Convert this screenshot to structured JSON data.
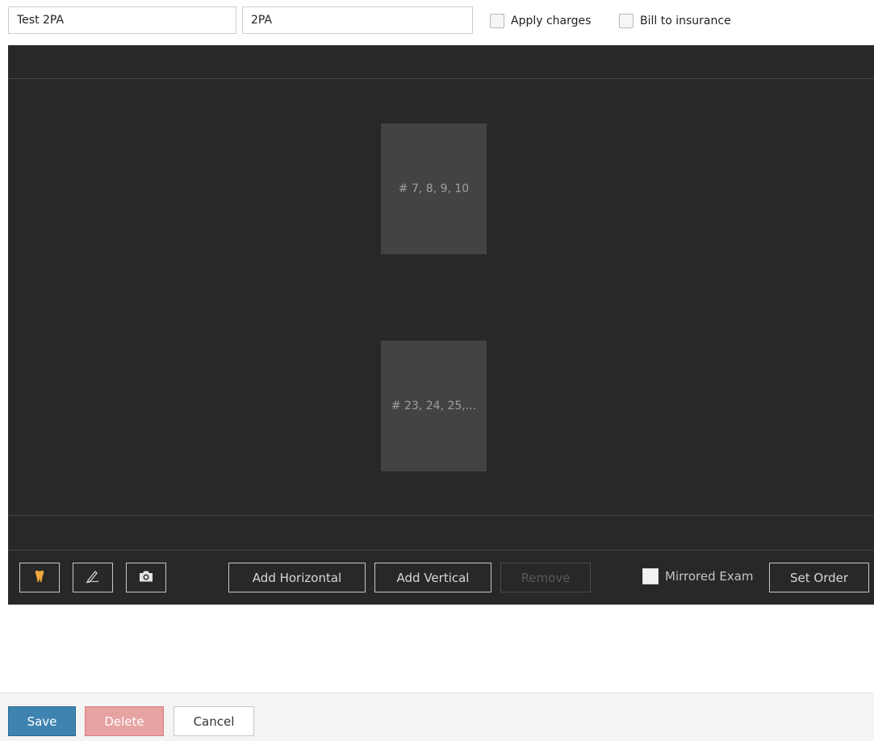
{
  "form": {
    "name_value": "Test 2PA",
    "code_value": "2PA",
    "apply_charges_label": "Apply charges",
    "bill_to_insurance_label": "Bill to insurance"
  },
  "layout": {
    "tiles": [
      {
        "label": "# 7, 8, 9, 10"
      },
      {
        "label": "# 23, 24, 25,..."
      }
    ]
  },
  "toolbar": {
    "tooth_icon": "tooth-icon",
    "pen_icon": "pen-icon",
    "camera_icon": "camera-icon",
    "add_horizontal_label": "Add Horizontal",
    "add_vertical_label": "Add Vertical",
    "remove_label": "Remove",
    "mirrored_exam_label": "Mirrored Exam",
    "set_order_label": "Set Order"
  },
  "footer": {
    "save_label": "Save",
    "delete_label": "Delete",
    "cancel_label": "Cancel"
  },
  "colors": {
    "canvas_bg": "#282828",
    "tile_bg": "#434343",
    "save_bg": "#3f84b1",
    "delete_bg": "#e7a2a2",
    "tooth_icon": "#f0a83a"
  }
}
